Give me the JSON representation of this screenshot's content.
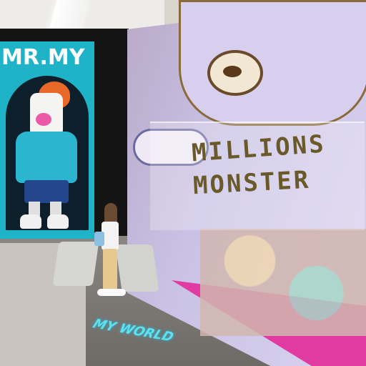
{
  "scene": {
    "poster_title": "MR.MY",
    "mural_line1": "MILLIONS",
    "mural_line2": "MONSTER",
    "floor_projection": "MY WORLD"
  },
  "colors": {
    "poster_cyan": "#1fb3c8",
    "poster_dark": "#0d1f2b",
    "hoodie": "#2bb5cf",
    "hat": "#e8682a",
    "floor": "#6f6c69",
    "mural_lavender": "#c9c2e6",
    "mural_magenta": "#e13aa0"
  }
}
